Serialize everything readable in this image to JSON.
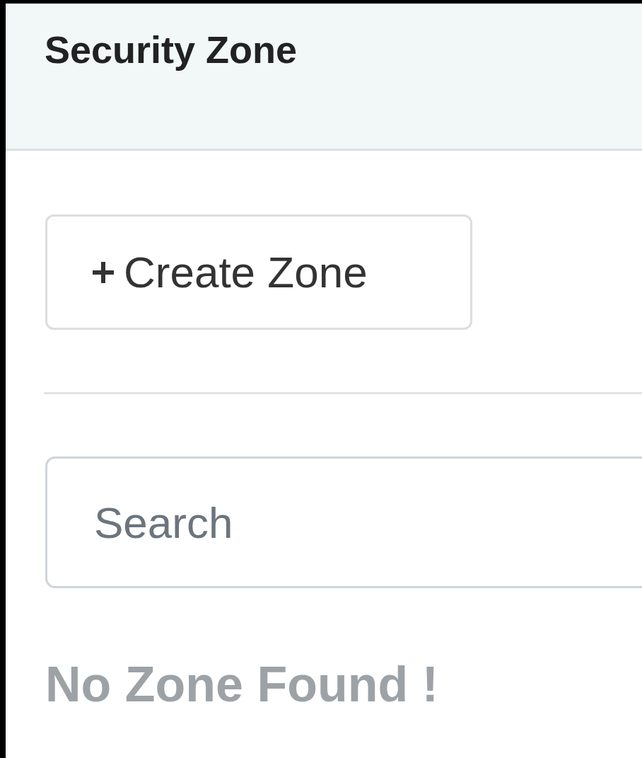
{
  "header": {
    "title": "Security Zone"
  },
  "create_button": {
    "label": "Create Zone"
  },
  "search": {
    "placeholder": "Search"
  },
  "empty_message": "No Zone Found !"
}
